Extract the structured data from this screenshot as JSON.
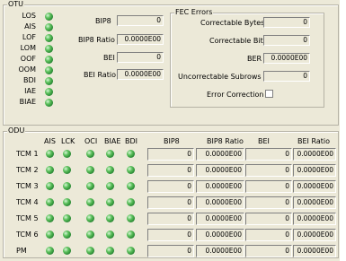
{
  "otu": {
    "title": "OTU",
    "alarms": [
      {
        "label": "LOS"
      },
      {
        "label": "AIS"
      },
      {
        "label": "LOF"
      },
      {
        "label": "LOM"
      },
      {
        "label": "OOF"
      },
      {
        "label": "OOM"
      },
      {
        "label": "BDI"
      },
      {
        "label": "IAE"
      },
      {
        "label": "BIAE"
      }
    ],
    "bip8_label": "BIP8",
    "bip8_value": "0",
    "bip8_ratio_label": "BIP8 Ratio",
    "bip8_ratio_value": "0.0000E00",
    "bei_label": "BEI",
    "bei_value": "0",
    "bei_ratio_label": "BEI Ratio",
    "bei_ratio_value": "0.0000E00"
  },
  "fec": {
    "title": "FEC Errors",
    "correctable_bytes_label": "Correctable Bytes",
    "correctable_bytes_value": "0",
    "correctable_bits_label": "Correctable Bits",
    "correctable_bits_value": "0",
    "ber_label": "BER",
    "ber_value": "0.0000E00",
    "uncorrectable_label": "Uncorrectable Subrows",
    "uncorrectable_value": "0",
    "error_correction_label": "Error Correction",
    "error_correction_checked": false
  },
  "odu": {
    "title": "ODU",
    "alarm_headers": [
      "AIS",
      "LCK",
      "OCI",
      "BIAE",
      "BDI"
    ],
    "value_headers": [
      "BIP8",
      "BIP8 Ratio",
      "BEI",
      "BEI Ratio"
    ],
    "rows": [
      {
        "label": "TCM 1",
        "bip8": "0",
        "bip8_ratio": "0.0000E00",
        "bei": "0",
        "bei_ratio": "0.0000E00"
      },
      {
        "label": "TCM 2",
        "bip8": "0",
        "bip8_ratio": "0.0000E00",
        "bei": "0",
        "bei_ratio": "0.0000E00"
      },
      {
        "label": "TCM 3",
        "bip8": "0",
        "bip8_ratio": "0.0000E00",
        "bei": "0",
        "bei_ratio": "0.0000E00"
      },
      {
        "label": "TCM 4",
        "bip8": "0",
        "bip8_ratio": "0.0000E00",
        "bei": "0",
        "bei_ratio": "0.0000E00"
      },
      {
        "label": "TCM 5",
        "bip8": "0",
        "bip8_ratio": "0.0000E00",
        "bei": "0",
        "bei_ratio": "0.0000E00"
      },
      {
        "label": "TCM 6",
        "bip8": "0",
        "bip8_ratio": "0.0000E00",
        "bei": "0",
        "bei_ratio": "0.0000E00"
      },
      {
        "label": "PM",
        "bip8": "0",
        "bip8_ratio": "0.0000E00",
        "bei": "0",
        "bei_ratio": "0.0000E00"
      }
    ]
  },
  "colors": {
    "panel": "#ece9d8",
    "led_green": "#2e9a3a"
  }
}
